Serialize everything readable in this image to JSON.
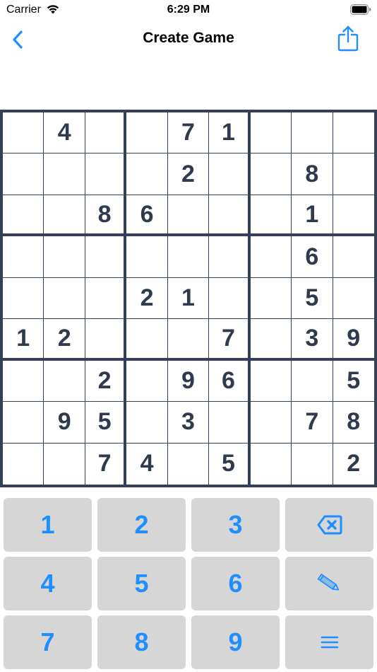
{
  "status_bar": {
    "carrier": "Carrier",
    "time": "6:29 PM"
  },
  "nav": {
    "title": "Create Game",
    "back_icon": "chevron-left-icon",
    "share_icon": "share-icon"
  },
  "colors": {
    "accent": "#1f8fff",
    "grid": "#34405a",
    "digit": "#303a4f",
    "key_bg": "#d6d6d6"
  },
  "board": {
    "rows": [
      [
        "",
        "4",
        "",
        "",
        "7",
        "1",
        "",
        "",
        ""
      ],
      [
        "",
        "",
        "",
        "",
        "2",
        "",
        "",
        "8",
        ""
      ],
      [
        "",
        "",
        "8",
        "6",
        "",
        "",
        "",
        "1",
        ""
      ],
      [
        "",
        "",
        "",
        "",
        "",
        "",
        "",
        "6",
        ""
      ],
      [
        "",
        "",
        "",
        "2",
        "1",
        "",
        "",
        "5",
        ""
      ],
      [
        "1",
        "2",
        "",
        "",
        "",
        "7",
        "",
        "3",
        "9"
      ],
      [
        "",
        "",
        "2",
        "",
        "9",
        "6",
        "",
        "",
        "5"
      ],
      [
        "",
        "9",
        "5",
        "",
        "3",
        "",
        "",
        "7",
        "8"
      ],
      [
        "",
        "",
        "7",
        "4",
        "",
        "5",
        "",
        "",
        "2"
      ]
    ]
  },
  "keypad": {
    "k1": "1",
    "k2": "2",
    "k3": "3",
    "k4": "4",
    "k5": "5",
    "k6": "6",
    "k7": "7",
    "k8": "8",
    "k9": "9",
    "delete_icon": "delete-backspace-icon",
    "pencil_icon": "pencil-icon",
    "menu_icon": "menu-lines-icon"
  }
}
